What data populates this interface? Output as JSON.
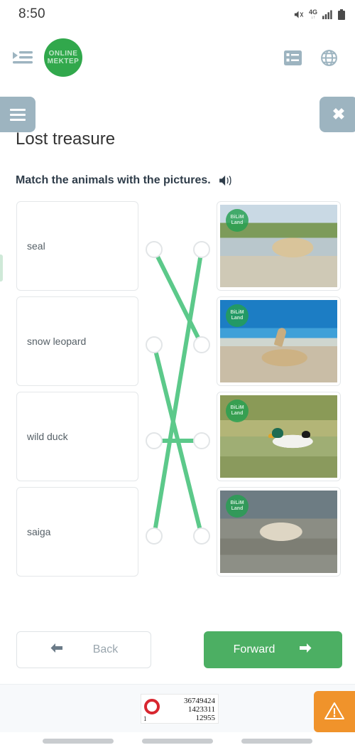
{
  "status_bar": {
    "time": "8:50",
    "icons": [
      "mute-icon",
      "network-4g",
      "signal-bars",
      "battery"
    ],
    "network_label": "4G",
    "network_arrows": "↓↑"
  },
  "header": {
    "menu_icon": "indent-list-icon",
    "logo_line1": "ONLINE",
    "logo_line2": "MEKTEP",
    "logo_color": "#31a84c",
    "right_icons": [
      "list-view-icon",
      "globe-language-icon"
    ]
  },
  "action_row": {
    "burger_label": "menu",
    "close_label": "✖",
    "button_color": "#9db4c0"
  },
  "lesson": {
    "title": "Lost treasure",
    "instruction": "Match the animals with the pictures.",
    "sound_icon": "speaker-icon"
  },
  "match": {
    "left_items": [
      {
        "id": "l1",
        "label": "seal"
      },
      {
        "id": "l2",
        "label": "snow leopard"
      },
      {
        "id": "l3",
        "label": "wild duck"
      },
      {
        "id": "l4",
        "label": "saiga"
      }
    ],
    "right_items": [
      {
        "id": "r1",
        "alt": "saiga antelope walking in shallow water",
        "watermark_l1": "BiLiM",
        "watermark_l2": "Land"
      },
      {
        "id": "r2",
        "alt": "seal resting on rocks by blue sea",
        "watermark_l1": "BiLiM",
        "watermark_l2": "Land"
      },
      {
        "id": "r3",
        "alt": "mallard wild duck swimming on green water",
        "watermark_l1": "BiLiM",
        "watermark_l2": "Land"
      },
      {
        "id": "r4",
        "alt": "snow leopard standing on rocks",
        "watermark_l1": "BiLiM",
        "watermark_l2": "Land"
      }
    ],
    "connections": [
      {
        "from": "l1",
        "to": "r2"
      },
      {
        "from": "l2",
        "to": "r4"
      },
      {
        "from": "l3",
        "to": "r3"
      },
      {
        "from": "l4",
        "to": "r1"
      }
    ],
    "line_color": "#5cc98a",
    "dot_border_color": "#e2e5e7"
  },
  "footer": {
    "back_label": "Back",
    "back_icon": "arrow-left-icon",
    "forward_label": "Forward",
    "forward_icon": "arrow-right-icon",
    "forward_color": "#4caf63"
  },
  "bottom_overlay": {
    "counter": {
      "ring_color": "#d8262f",
      "values": [
        "36749424",
        "1423311",
        "12955"
      ],
      "left_digit": "1"
    },
    "warning_button": {
      "icon": "warning-triangle-icon",
      "color": "#f0932b"
    }
  },
  "nav_bar": {
    "pills": [
      "recents-pill",
      "home-pill",
      "back-pill"
    ]
  }
}
